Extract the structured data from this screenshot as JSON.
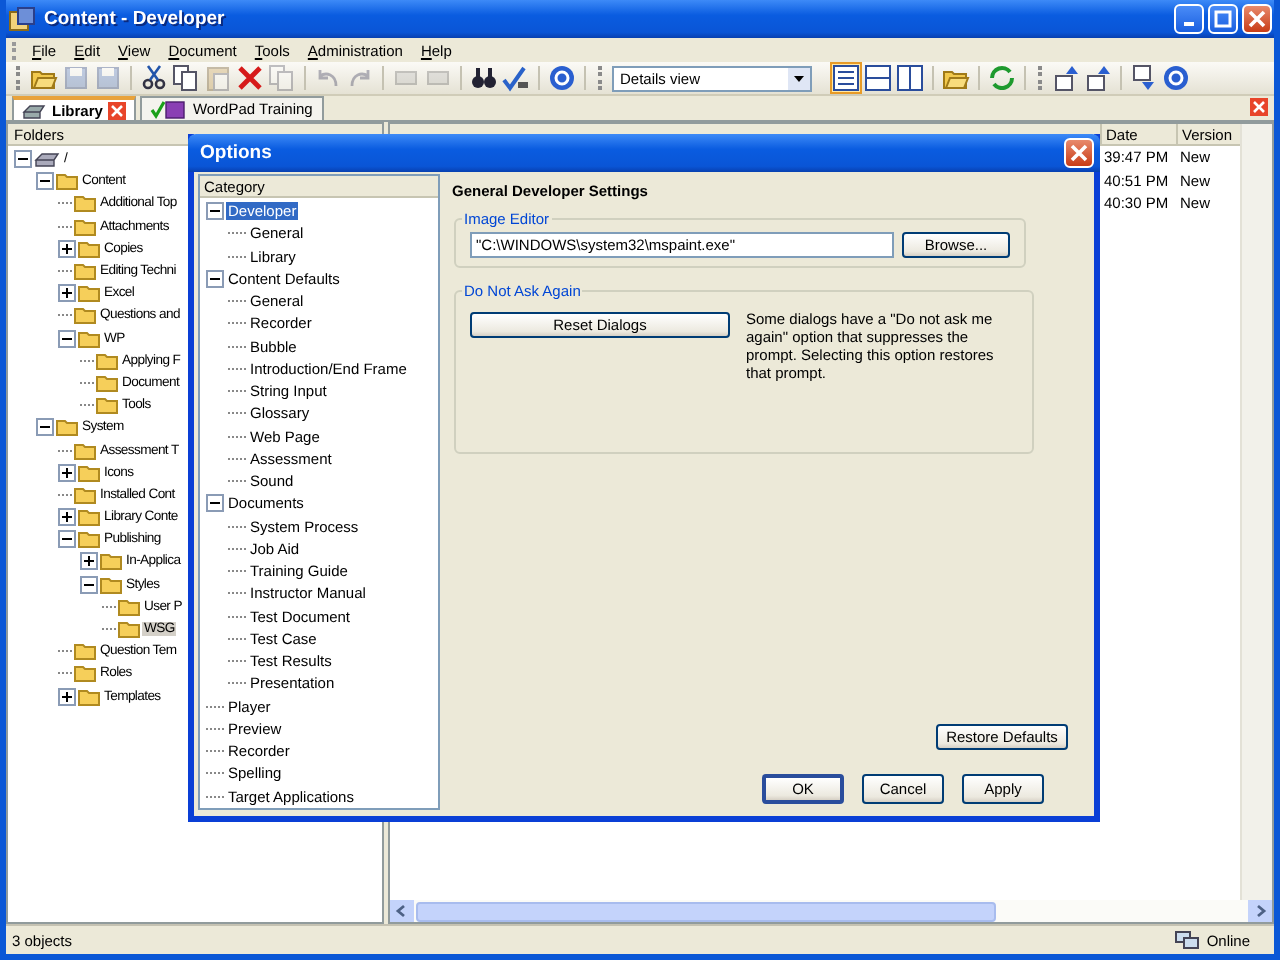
{
  "window": {
    "title": "Content - Developer"
  },
  "menu": [
    "File",
    "Edit",
    "View",
    "Document",
    "Tools",
    "Administration",
    "Help"
  ],
  "toolbar": {
    "view_select": "Details view"
  },
  "tabs": [
    {
      "label": "Library",
      "selected": true
    },
    {
      "label": "WordPad Training",
      "selected": false
    }
  ],
  "folders": {
    "header": "Folders",
    "tree": [
      {
        "label": "/",
        "expanded": true,
        "selected": false,
        "children": [
          {
            "label": "Content",
            "expanded": true,
            "selected": false,
            "children": [
              {
                "label": "Additional Top",
                "selected": false
              },
              {
                "label": "Attachments",
                "selected": false
              },
              {
                "label": "Copies",
                "expanded": false,
                "selected": false
              },
              {
                "label": "Editing Techni",
                "selected": false
              },
              {
                "label": "Excel",
                "expanded": false,
                "selected": false
              },
              {
                "label": "Questions and",
                "selected": false
              },
              {
                "label": "WP",
                "expanded": true,
                "selected": false,
                "children": [
                  {
                    "label": "Applying F",
                    "selected": false
                  },
                  {
                    "label": "Document",
                    "selected": false
                  },
                  {
                    "label": "Tools",
                    "selected": false
                  }
                ]
              }
            ]
          },
          {
            "label": "System",
            "expanded": true,
            "selected": false,
            "children": [
              {
                "label": "Assessment T",
                "selected": false
              },
              {
                "label": "Icons",
                "expanded": false,
                "selected": false
              },
              {
                "label": "Installed Cont",
                "selected": false
              },
              {
                "label": "Library Conte",
                "expanded": false,
                "selected": false
              },
              {
                "label": "Publishing",
                "expanded": true,
                "selected": false,
                "children": [
                  {
                    "label": "In-Applica",
                    "expanded": false,
                    "selected": false
                  },
                  {
                    "label": "Styles",
                    "expanded": true,
                    "selected": false,
                    "children": [
                      {
                        "label": "User P",
                        "selected": false
                      },
                      {
                        "label": "WSG",
                        "selected": true
                      }
                    ]
                  }
                ]
              },
              {
                "label": "Question Tem",
                "selected": false
              },
              {
                "label": "Roles",
                "selected": false
              },
              {
                "label": "Templates",
                "expanded": false,
                "selected": false
              }
            ]
          }
        ]
      }
    ]
  },
  "list": {
    "columns": [
      "Date",
      "Version"
    ],
    "rows": [
      [
        "39:47 PM",
        "New"
      ],
      [
        "40:51 PM",
        "New"
      ],
      [
        "40:30 PM",
        "New"
      ]
    ]
  },
  "dialog": {
    "title": "Options",
    "category_header": "Category",
    "categories": [
      {
        "label": "Developer",
        "expanded": true,
        "selected": true,
        "children": [
          {
            "label": "General",
            "selected": false
          },
          {
            "label": "Library",
            "selected": false
          }
        ]
      },
      {
        "label": "Content Defaults",
        "expanded": true,
        "selected": false,
        "children": [
          {
            "label": "General",
            "selected": false
          },
          {
            "label": "Recorder",
            "selected": false
          },
          {
            "label": "Bubble",
            "selected": false
          },
          {
            "label": "Introduction/End Frame",
            "selected": false
          },
          {
            "label": "String Input",
            "selected": false
          },
          {
            "label": "Glossary",
            "selected": false
          },
          {
            "label": "Web Page",
            "selected": false
          },
          {
            "label": "Assessment",
            "selected": false
          },
          {
            "label": "Sound",
            "selected": false
          }
        ]
      },
      {
        "label": "Documents",
        "expanded": true,
        "selected": false,
        "children": [
          {
            "label": "System Process",
            "selected": false
          },
          {
            "label": "Job Aid",
            "selected": false
          },
          {
            "label": "Training Guide",
            "selected": false
          },
          {
            "label": "Instructor Manual",
            "selected": false
          },
          {
            "label": "Test Document",
            "selected": false
          },
          {
            "label": "Test Case",
            "selected": false
          },
          {
            "label": "Test Results",
            "selected": false
          },
          {
            "label": "Presentation",
            "selected": false
          }
        ]
      },
      {
        "label": "Player",
        "selected": false
      },
      {
        "label": "Preview",
        "selected": false
      },
      {
        "label": "Recorder",
        "selected": false
      },
      {
        "label": "Spelling",
        "selected": false
      },
      {
        "label": "Target Applications",
        "selected": false
      }
    ],
    "heading": "General Developer Settings",
    "image_editor": {
      "label": "Image Editor",
      "value": "\"C:\\WINDOWS\\system32\\mspaint.exe\"",
      "button": "Browse..."
    },
    "do_not_ask": {
      "label": "Do Not Ask Again",
      "button": "Reset Dialogs",
      "description": "Some dialogs have a \"Do not ask me again\" option that suppresses the prompt. Selecting this option restores that prompt."
    },
    "restore_button": "Restore Defaults",
    "buttons": [
      "OK",
      "Cancel",
      "Apply"
    ]
  },
  "status_bar": {
    "text": "3 objects",
    "connection": "Online"
  }
}
